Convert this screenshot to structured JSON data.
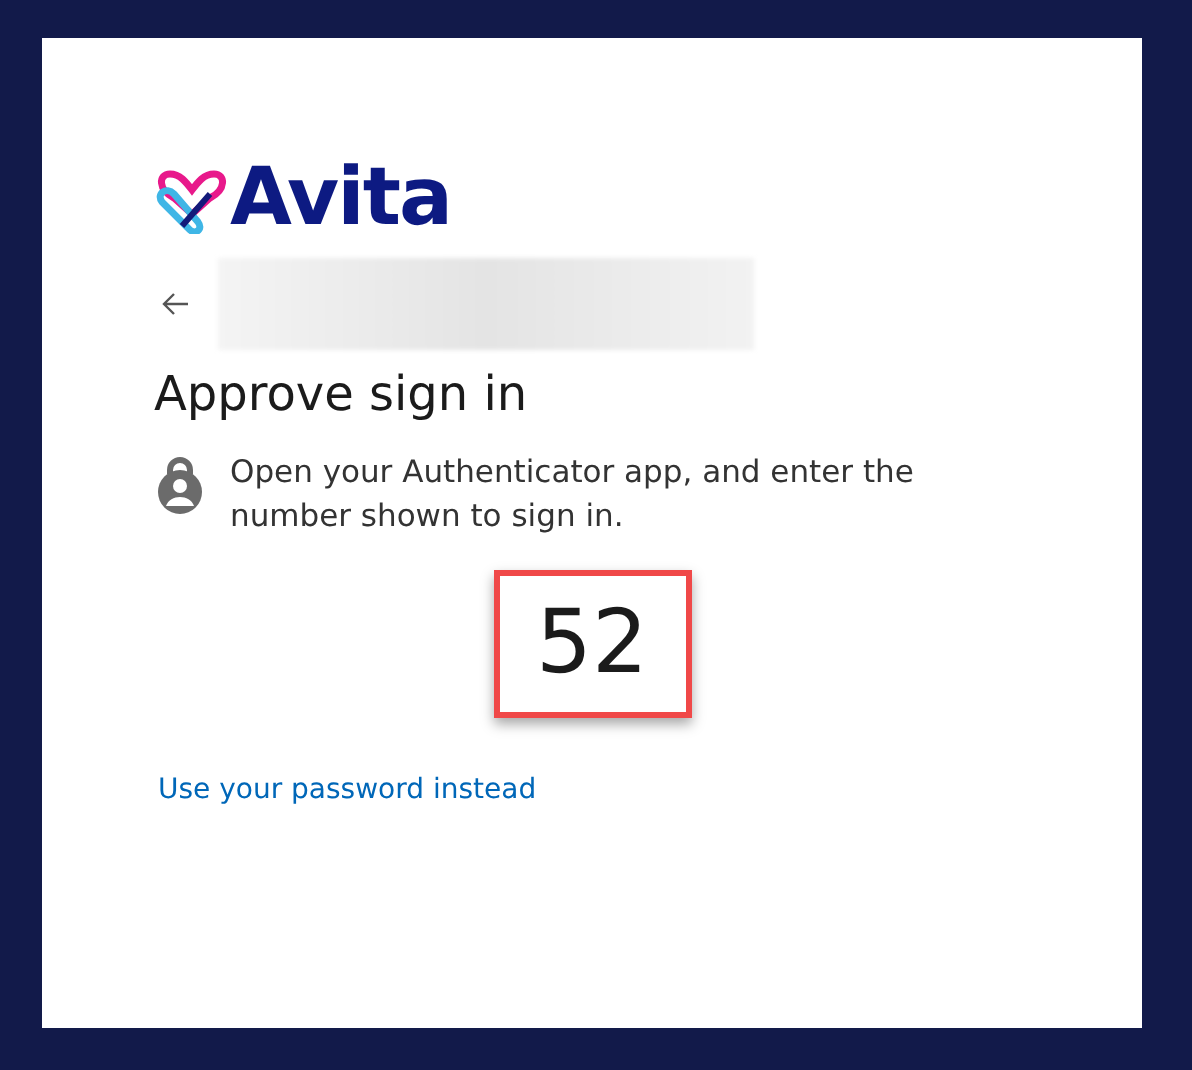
{
  "logo": {
    "text": "Avita"
  },
  "title": "Approve sign in",
  "instruction": "Open your Authenticator app, and enter the number shown to sign in.",
  "number": "52",
  "link": "Use your password instead"
}
